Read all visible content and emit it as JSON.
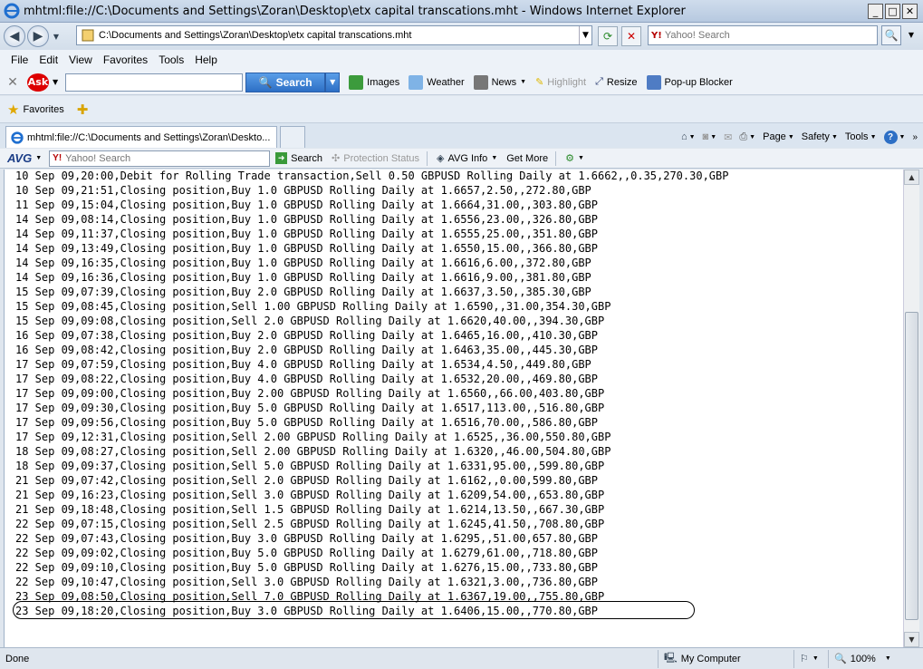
{
  "window": {
    "title": "mhtml:file://C:\\Documents and Settings\\Zoran\\Desktop\\etx capital transcations.mht - Windows Internet Explorer"
  },
  "address": {
    "url": "C:\\Documents and Settings\\Zoran\\Desktop\\etx capital transcations.mht"
  },
  "search": {
    "placeholder": "Yahoo! Search"
  },
  "menu": [
    "File",
    "Edit",
    "View",
    "Favorites",
    "Tools",
    "Help"
  ],
  "ask_toolbar": {
    "logo": "Ask",
    "search_label": "Search",
    "items": [
      "Images",
      "Weather",
      "News",
      "Highlight",
      "Resize",
      "Pop-up Blocker"
    ]
  },
  "favorites_bar": {
    "label": "Favorites"
  },
  "tab": {
    "title": "mhtml:file://C:\\Documents and Settings\\Zoran\\Deskto..."
  },
  "command_bar": {
    "page": "Page",
    "safety": "Safety",
    "tools": "Tools"
  },
  "avg_toolbar": {
    "logo": "AVG",
    "search_placeholder": "Yahoo! Search",
    "search_label": "Search",
    "protection": "Protection Status",
    "avg_info": "AVG Info",
    "get_more": "Get More"
  },
  "content": {
    "lines": [
      "10 Sep 09,20:00,Debit for Rolling Trade transaction,Sell 0.50 GBPUSD Rolling Daily at 1.6662,,0.35,270.30,GBP",
      "10 Sep 09,21:51,Closing position,Buy 1.0 GBPUSD Rolling Daily at 1.6657,2.50,,272.80,GBP",
      "11 Sep 09,15:04,Closing position,Buy 1.0 GBPUSD Rolling Daily at 1.6664,31.00,,303.80,GBP",
      "14 Sep 09,08:14,Closing position,Buy 1.0 GBPUSD Rolling Daily at 1.6556,23.00,,326.80,GBP",
      "14 Sep 09,11:37,Closing position,Buy 1.0 GBPUSD Rolling Daily at 1.6555,25.00,,351.80,GBP",
      "14 Sep 09,13:49,Closing position,Buy 1.0 GBPUSD Rolling Daily at 1.6550,15.00,,366.80,GBP",
      "14 Sep 09,16:35,Closing position,Buy 1.0 GBPUSD Rolling Daily at 1.6616,6.00,,372.80,GBP",
      "14 Sep 09,16:36,Closing position,Buy 1.0 GBPUSD Rolling Daily at 1.6616,9.00,,381.80,GBP",
      "15 Sep 09,07:39,Closing position,Buy 2.0 GBPUSD Rolling Daily at 1.6637,3.50,,385.30,GBP",
      "15 Sep 09,08:45,Closing position,Sell 1.00 GBPUSD Rolling Daily at 1.6590,,31.00,354.30,GBP",
      "15 Sep 09,09:08,Closing position,Sell 2.0 GBPUSD Rolling Daily at 1.6620,40.00,,394.30,GBP",
      "16 Sep 09,07:38,Closing position,Buy 2.0 GBPUSD Rolling Daily at 1.6465,16.00,,410.30,GBP",
      "16 Sep 09,08:42,Closing position,Buy 2.0 GBPUSD Rolling Daily at 1.6463,35.00,,445.30,GBP",
      "17 Sep 09,07:59,Closing position,Buy 4.0 GBPUSD Rolling Daily at 1.6534,4.50,,449.80,GBP",
      "17 Sep 09,08:22,Closing position,Buy 4.0 GBPUSD Rolling Daily at 1.6532,20.00,,469.80,GBP",
      "17 Sep 09,09:00,Closing position,Buy 2.00 GBPUSD Rolling Daily at 1.6560,,66.00,403.80,GBP",
      "17 Sep 09,09:30,Closing position,Buy 5.0 GBPUSD Rolling Daily at 1.6517,113.00,,516.80,GBP",
      "17 Sep 09,09:56,Closing position,Buy 5.0 GBPUSD Rolling Daily at 1.6516,70.00,,586.80,GBP",
      "17 Sep 09,12:31,Closing position,Sell 2.00 GBPUSD Rolling Daily at 1.6525,,36.00,550.80,GBP",
      "18 Sep 09,08:27,Closing position,Sell 2.00 GBPUSD Rolling Daily at 1.6320,,46.00,504.80,GBP",
      "18 Sep 09,09:37,Closing position,Sell 5.0 GBPUSD Rolling Daily at 1.6331,95.00,,599.80,GBP",
      "21 Sep 09,07:42,Closing position,Sell 2.0 GBPUSD Rolling Daily at 1.6162,,0.00,599.80,GBP",
      "21 Sep 09,16:23,Closing position,Sell 3.0 GBPUSD Rolling Daily at 1.6209,54.00,,653.80,GBP",
      "21 Sep 09,18:48,Closing position,Sell 1.5 GBPUSD Rolling Daily at 1.6214,13.50,,667.30,GBP",
      "22 Sep 09,07:15,Closing position,Sell 2.5 GBPUSD Rolling Daily at 1.6245,41.50,,708.80,GBP",
      "22 Sep 09,07:43,Closing position,Buy 3.0 GBPUSD Rolling Daily at 1.6295,,51.00,657.80,GBP",
      "22 Sep 09,09:02,Closing position,Buy 5.0 GBPUSD Rolling Daily at 1.6279,61.00,,718.80,GBP",
      "22 Sep 09,09:10,Closing position,Buy 5.0 GBPUSD Rolling Daily at 1.6276,15.00,,733.80,GBP",
      "22 Sep 09,10:47,Closing position,Sell 3.0 GBPUSD Rolling Daily at 1.6321,3.00,,736.80,GBP",
      "23 Sep 09,08:50,Closing position,Sell 7.0 GBPUSD Rolling Daily at 1.6367,19.00,,755.80,GBP",
      "23 Sep 09,18:20,Closing position,Buy 3.0 GBPUSD Rolling Daily at 1.6406,15.00,,770.80,GBP"
    ]
  },
  "status": {
    "text": "Done",
    "zone": "My Computer",
    "zoom": "100%"
  }
}
